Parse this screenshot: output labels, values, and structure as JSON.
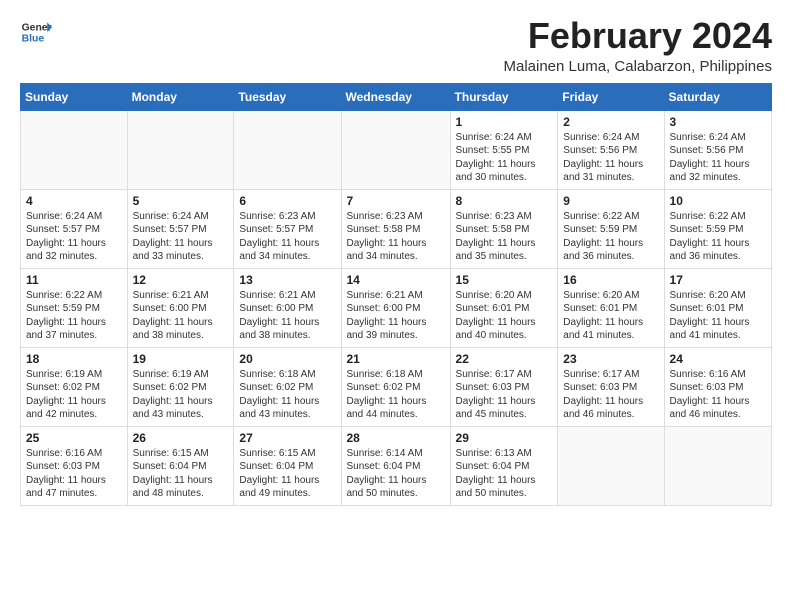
{
  "header": {
    "logo_general": "General",
    "logo_blue": "Blue",
    "month_year": "February 2024",
    "location": "Malainen Luma, Calabarzon, Philippines"
  },
  "weekdays": [
    "Sunday",
    "Monday",
    "Tuesday",
    "Wednesday",
    "Thursday",
    "Friday",
    "Saturday"
  ],
  "weeks": [
    [
      {
        "day": "",
        "info": ""
      },
      {
        "day": "",
        "info": ""
      },
      {
        "day": "",
        "info": ""
      },
      {
        "day": "",
        "info": ""
      },
      {
        "day": "1",
        "info": "Sunrise: 6:24 AM\nSunset: 5:55 PM\nDaylight: 11 hours and 30 minutes."
      },
      {
        "day": "2",
        "info": "Sunrise: 6:24 AM\nSunset: 5:56 PM\nDaylight: 11 hours and 31 minutes."
      },
      {
        "day": "3",
        "info": "Sunrise: 6:24 AM\nSunset: 5:56 PM\nDaylight: 11 hours and 32 minutes."
      }
    ],
    [
      {
        "day": "4",
        "info": "Sunrise: 6:24 AM\nSunset: 5:57 PM\nDaylight: 11 hours and 32 minutes."
      },
      {
        "day": "5",
        "info": "Sunrise: 6:24 AM\nSunset: 5:57 PM\nDaylight: 11 hours and 33 minutes."
      },
      {
        "day": "6",
        "info": "Sunrise: 6:23 AM\nSunset: 5:57 PM\nDaylight: 11 hours and 34 minutes."
      },
      {
        "day": "7",
        "info": "Sunrise: 6:23 AM\nSunset: 5:58 PM\nDaylight: 11 hours and 34 minutes."
      },
      {
        "day": "8",
        "info": "Sunrise: 6:23 AM\nSunset: 5:58 PM\nDaylight: 11 hours and 35 minutes."
      },
      {
        "day": "9",
        "info": "Sunrise: 6:22 AM\nSunset: 5:59 PM\nDaylight: 11 hours and 36 minutes."
      },
      {
        "day": "10",
        "info": "Sunrise: 6:22 AM\nSunset: 5:59 PM\nDaylight: 11 hours and 36 minutes."
      }
    ],
    [
      {
        "day": "11",
        "info": "Sunrise: 6:22 AM\nSunset: 5:59 PM\nDaylight: 11 hours and 37 minutes."
      },
      {
        "day": "12",
        "info": "Sunrise: 6:21 AM\nSunset: 6:00 PM\nDaylight: 11 hours and 38 minutes."
      },
      {
        "day": "13",
        "info": "Sunrise: 6:21 AM\nSunset: 6:00 PM\nDaylight: 11 hours and 38 minutes."
      },
      {
        "day": "14",
        "info": "Sunrise: 6:21 AM\nSunset: 6:00 PM\nDaylight: 11 hours and 39 minutes."
      },
      {
        "day": "15",
        "info": "Sunrise: 6:20 AM\nSunset: 6:01 PM\nDaylight: 11 hours and 40 minutes."
      },
      {
        "day": "16",
        "info": "Sunrise: 6:20 AM\nSunset: 6:01 PM\nDaylight: 11 hours and 41 minutes."
      },
      {
        "day": "17",
        "info": "Sunrise: 6:20 AM\nSunset: 6:01 PM\nDaylight: 11 hours and 41 minutes."
      }
    ],
    [
      {
        "day": "18",
        "info": "Sunrise: 6:19 AM\nSunset: 6:02 PM\nDaylight: 11 hours and 42 minutes."
      },
      {
        "day": "19",
        "info": "Sunrise: 6:19 AM\nSunset: 6:02 PM\nDaylight: 11 hours and 43 minutes."
      },
      {
        "day": "20",
        "info": "Sunrise: 6:18 AM\nSunset: 6:02 PM\nDaylight: 11 hours and 43 minutes."
      },
      {
        "day": "21",
        "info": "Sunrise: 6:18 AM\nSunset: 6:02 PM\nDaylight: 11 hours and 44 minutes."
      },
      {
        "day": "22",
        "info": "Sunrise: 6:17 AM\nSunset: 6:03 PM\nDaylight: 11 hours and 45 minutes."
      },
      {
        "day": "23",
        "info": "Sunrise: 6:17 AM\nSunset: 6:03 PM\nDaylight: 11 hours and 46 minutes."
      },
      {
        "day": "24",
        "info": "Sunrise: 6:16 AM\nSunset: 6:03 PM\nDaylight: 11 hours and 46 minutes."
      }
    ],
    [
      {
        "day": "25",
        "info": "Sunrise: 6:16 AM\nSunset: 6:03 PM\nDaylight: 11 hours and 47 minutes."
      },
      {
        "day": "26",
        "info": "Sunrise: 6:15 AM\nSunset: 6:04 PM\nDaylight: 11 hours and 48 minutes."
      },
      {
        "day": "27",
        "info": "Sunrise: 6:15 AM\nSunset: 6:04 PM\nDaylight: 11 hours and 49 minutes."
      },
      {
        "day": "28",
        "info": "Sunrise: 6:14 AM\nSunset: 6:04 PM\nDaylight: 11 hours and 50 minutes."
      },
      {
        "day": "29",
        "info": "Sunrise: 6:13 AM\nSunset: 6:04 PM\nDaylight: 11 hours and 50 minutes."
      },
      {
        "day": "",
        "info": ""
      },
      {
        "day": "",
        "info": ""
      }
    ]
  ]
}
